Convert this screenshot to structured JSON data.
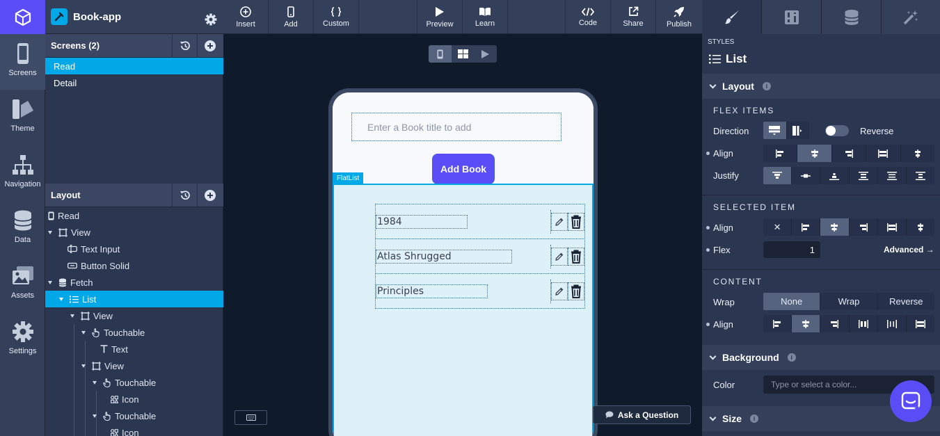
{
  "app": {
    "name": "Book-app"
  },
  "rail": {
    "items": [
      {
        "label": "Screens",
        "icon": "phone-icon"
      },
      {
        "label": "Theme",
        "icon": "theme-icon"
      },
      {
        "label": "Navigation",
        "icon": "navigation-icon"
      },
      {
        "label": "Data",
        "icon": "database-icon"
      },
      {
        "label": "Assets",
        "icon": "image-icon"
      },
      {
        "label": "Settings",
        "icon": "gear-icon"
      }
    ],
    "active": "Screens"
  },
  "screens": {
    "title": "Screens (2)",
    "items": [
      "Read",
      "Detail"
    ],
    "active": "Read"
  },
  "layout": {
    "title": "Layout",
    "tree": [
      {
        "label": "Read",
        "icon": "phone-icon"
      },
      {
        "label": "View",
        "icon": "view-icon"
      },
      {
        "label": "Text Input",
        "icon": "text-input-icon"
      },
      {
        "label": "Button Solid",
        "icon": "button-icon"
      },
      {
        "label": "Fetch",
        "icon": "database-icon"
      },
      {
        "label": "List",
        "icon": "list-icon"
      },
      {
        "label": "View",
        "icon": "view-icon"
      },
      {
        "label": "Touchable",
        "icon": "touch-icon"
      },
      {
        "label": "Text",
        "icon": "text-icon"
      },
      {
        "label": "View",
        "icon": "view-icon"
      },
      {
        "label": "Touchable",
        "icon": "touch-icon"
      },
      {
        "label": "Icon",
        "icon": "icon-component-icon"
      },
      {
        "label": "Touchable",
        "icon": "touch-icon"
      },
      {
        "label": "Icon",
        "icon": "icon-component-icon"
      }
    ],
    "active_index": 5
  },
  "toolbar": {
    "insert": "Insert",
    "add": "Add",
    "custom": "Custom",
    "preview": "Preview",
    "learn": "Learn",
    "code": "Code",
    "share": "Share",
    "publish": "Publish"
  },
  "canvas": {
    "input_placeholder": "Enter a Book title to add",
    "add_button": "Add Book",
    "flatlist_tag": "FlatList",
    "books": [
      "1984",
      "Atlas Shrugged",
      "Principles"
    ],
    "ask_button": "Ask a Question"
  },
  "styles": {
    "caption": "STYLES",
    "component": "List",
    "layout_section": "Layout",
    "flex_items_caption": "FLEX ITEMS",
    "direction_label": "Direction",
    "reverse_label": "Reverse",
    "align_label": "Align",
    "justify_label": "Justify",
    "selected_item_caption": "SELECTED ITEM",
    "flex_label": "Flex",
    "flex_value": "1",
    "advanced_link": "Advanced →",
    "content_caption": "CONTENT",
    "wrap_label": "Wrap",
    "wrap_options": [
      "None",
      "Wrap",
      "Reverse"
    ],
    "wrap_selected": "None",
    "background_section": "Background",
    "color_label": "Color",
    "color_placeholder": "Type or select a color...",
    "size_section": "Size",
    "selected_item_align_none": "✕"
  },
  "colors": {
    "accent": "#5a4df6",
    "selection": "#00a8e8",
    "panel": "#2b3750",
    "canvas": "#0f1a2a"
  }
}
